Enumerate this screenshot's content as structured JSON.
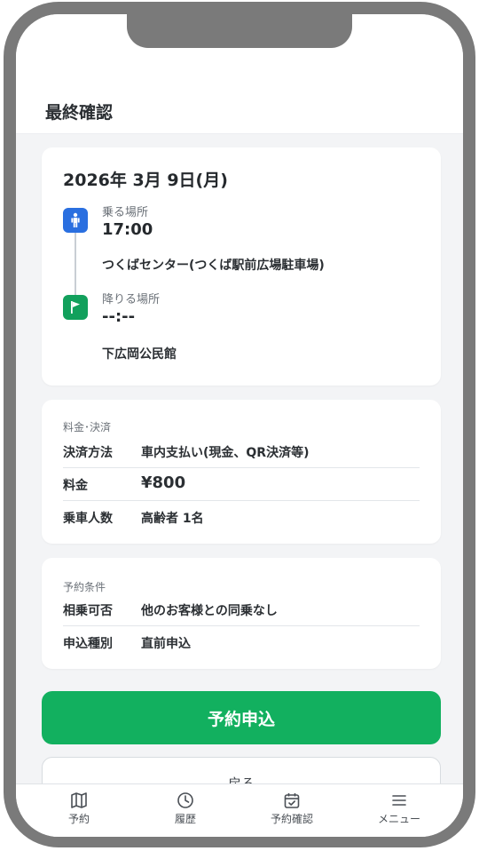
{
  "header": {
    "title": "最終確認"
  },
  "route": {
    "date": "2026年 3月 9日(月)",
    "pickup": {
      "label": "乗る場所",
      "time": "17:00",
      "place": "つくばセンター(つくば駅前広場駐車場)"
    },
    "dropoff": {
      "label": "降りる場所",
      "time": "--:--",
      "place": "下広岡公民館"
    }
  },
  "payment": {
    "section_title": "料金･決済",
    "rows": [
      {
        "key": "決済方法",
        "value": "車内支払い(現金、QR決済等)"
      },
      {
        "key": "料金",
        "value": "¥800"
      },
      {
        "key": "乗車人数",
        "value": "高齢者 1名"
      }
    ]
  },
  "conditions": {
    "section_title": "予約条件",
    "rows": [
      {
        "key": "相乗可否",
        "value": "他のお客様との同乗なし"
      },
      {
        "key": "申込種別",
        "value": "直前申込"
      }
    ]
  },
  "buttons": {
    "submit": "予約申込",
    "back": "戻る"
  },
  "tabs": [
    {
      "label": "予約",
      "icon": "map-icon"
    },
    {
      "label": "履歴",
      "icon": "clock-icon"
    },
    {
      "label": "予約確認",
      "icon": "calendar-check-icon"
    },
    {
      "label": "メニュー",
      "icon": "menu-icon"
    }
  ],
  "colors": {
    "primary": "#12b05f",
    "pickup": "#2a6fe0",
    "dropoff": "#12a05c"
  }
}
